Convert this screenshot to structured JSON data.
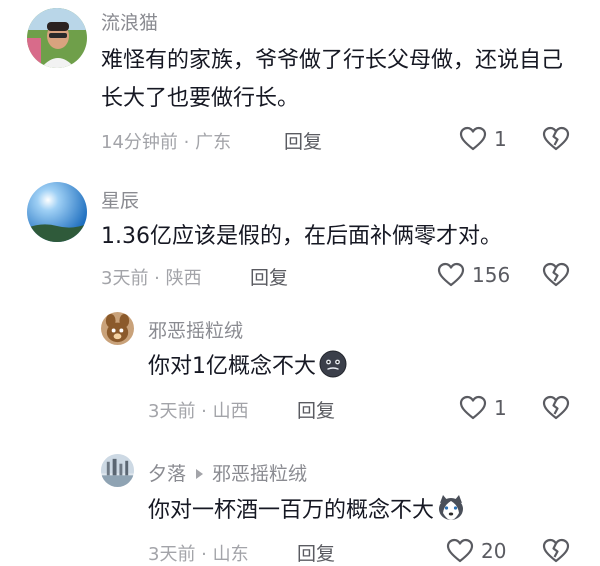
{
  "comments": [
    {
      "username": "流浪猫",
      "text": "难怪有的家族，爷爷做了行长父母做，还说自己长大了也要做行长。",
      "time": "14分钟前 · 广东",
      "reply_label": "回复",
      "likes": "1"
    },
    {
      "username": "星辰",
      "text": "1.36亿应该是假的，在后面补俩零才对。",
      "time": "3天前 · 陕西",
      "reply_label": "回复",
      "likes": "156"
    }
  ],
  "replies": [
    {
      "username": "邪恶摇粒绒",
      "text": "你对1亿概念不大",
      "emoji": "dark-face-emoji",
      "time": "3天前 · 山西",
      "reply_label": "回复",
      "likes": "1"
    },
    {
      "username": "夕落",
      "reply_to": "邪恶摇粒绒",
      "text": "你对一杯酒一百万的概念不大",
      "emoji": "husky-emoji",
      "time": "3天前 · 山东",
      "reply_label": "回复",
      "likes": "20"
    }
  ],
  "icons": {
    "like": "heart-outline-icon",
    "dislike": "broken-heart-icon"
  }
}
